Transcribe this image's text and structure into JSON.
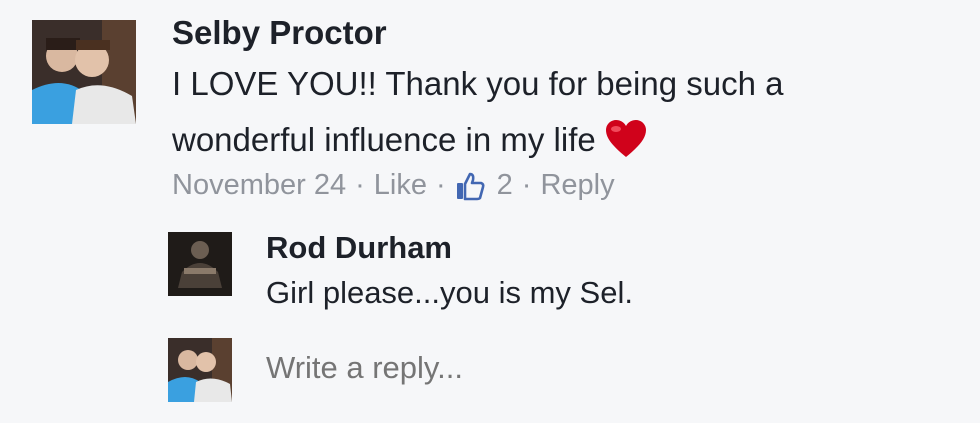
{
  "comment": {
    "author": "Selby Proctor",
    "text": "I LOVE YOU!! Thank you for being such a wonderful influence in my life",
    "date": "November 24",
    "like_label": "Like",
    "like_count": "2",
    "reply_label": "Reply",
    "separator": "·"
  },
  "reply": {
    "author": "Rod Durham",
    "text": "Girl please...you is my Sel."
  },
  "composer": {
    "placeholder": "Write a reply..."
  },
  "colors": {
    "text": "#1d2129",
    "meta": "#90949c",
    "like_blue": "#4267b2",
    "heart": "#d0021b"
  }
}
